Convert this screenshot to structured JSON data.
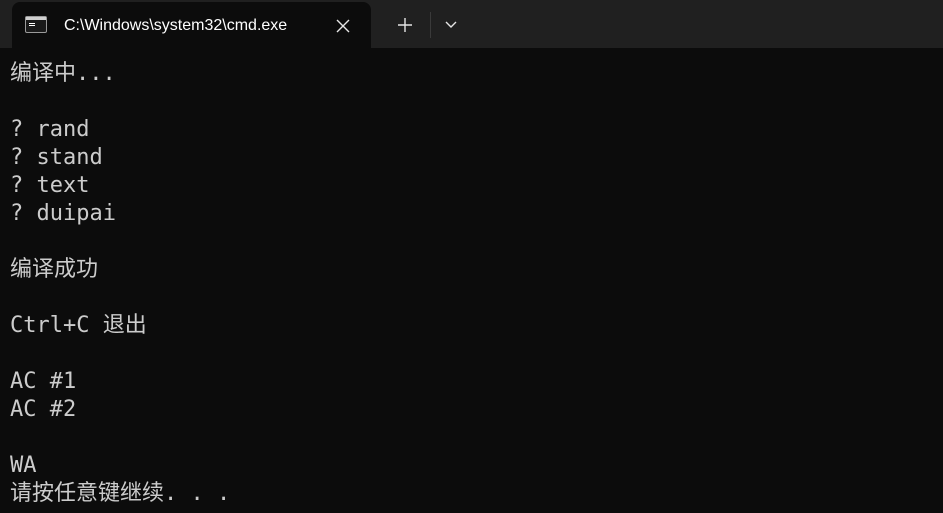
{
  "tab": {
    "title": "C:\\Windows\\system32\\cmd.exe",
    "icon": "cmd-icon"
  },
  "tabbar": {
    "close_icon": "close-icon",
    "new_tab_icon": "plus-icon",
    "dropdown_icon": "chevron-down-icon"
  },
  "console": {
    "lines": [
      "编译中...",
      "",
      "? rand",
      "? stand",
      "? text",
      "? duipai",
      "",
      "编译成功",
      "",
      "Ctrl+C 退出",
      "",
      "AC #1",
      "AC #2",
      "",
      "WA",
      "请按任意键继续. . ."
    ]
  },
  "colors": {
    "tabbar_bg": "#202020",
    "console_bg": "#0c0c0c",
    "console_text": "#cccccc",
    "title_text": "#ffffff"
  }
}
